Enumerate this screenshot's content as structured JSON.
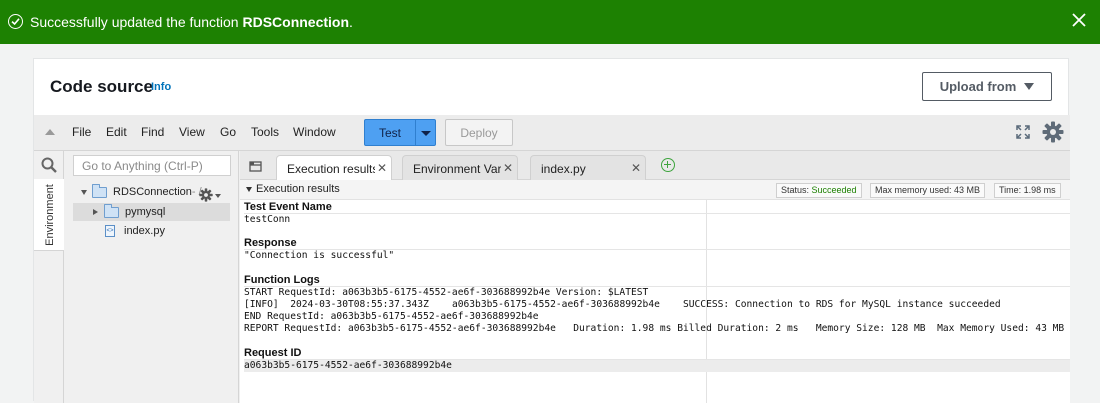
{
  "banner": {
    "message_prefix": "Successfully updated the function ",
    "function_name": "RDSConnection",
    "message_suffix": ".",
    "color": "#1d8102"
  },
  "card": {
    "title": "Code source",
    "info_link": "Info",
    "upload_button": "Upload from"
  },
  "menubar": {
    "items": [
      "File",
      "Edit",
      "Find",
      "View",
      "Go",
      "Tools",
      "Window"
    ],
    "test_button": "Test",
    "deploy_button": "Deploy",
    "accent": "#4ea0f2"
  },
  "sidebar": {
    "env_tab": "Environment",
    "search_placeholder": "Go to Anything (Ctrl-P)"
  },
  "tree": {
    "root": {
      "name": "RDSConnection",
      "suffix": " - /"
    },
    "items": [
      {
        "name": "pymysql",
        "type": "folder"
      },
      {
        "name": "index.py",
        "type": "file"
      }
    ]
  },
  "tabs": [
    {
      "label": "Execution results",
      "active": true
    },
    {
      "label": "Environment Vari",
      "active": false
    },
    {
      "label": "index.py",
      "active": false
    }
  ],
  "results": {
    "header": "Execution results",
    "status_label": "Status: ",
    "status_value": "Succeeded",
    "memory": "Max memory used: 43 MB",
    "time": "Time: 1.98 ms",
    "sections": {
      "test_event_title": "Test Event Name",
      "test_event_value": "testConn",
      "response_title": "Response",
      "response_value": "\"Connection is successful\"",
      "logs_title": "Function Logs",
      "logs": [
        "START RequestId: a063b3b5-6175-4552-ae6f-303688992b4e Version: $LATEST",
        "[INFO]\t2024-03-30T08:55:37.343Z\ta063b3b5-6175-4552-ae6f-303688992b4e\tSUCCESS: Connection to RDS for MySQL instance succeeded",
        "END RequestId: a063b3b5-6175-4552-ae6f-303688992b4e",
        "REPORT RequestId: a063b3b5-6175-4552-ae6f-303688992b4e\tDuration: 1.98 ms\tBilled Duration: 2 ms\tMemory Size: 128 MB\tMax Memory Used: 43 MB"
      ],
      "request_id_title": "Request ID",
      "request_id_value": "a063b3b5-6175-4552-ae6f-303688992b4e"
    }
  },
  "icons": [
    "check-circle-icon",
    "close-icon",
    "collapse-icon",
    "expand-icon",
    "gear-icon",
    "search-icon",
    "folder-icon",
    "file-icon",
    "tabs-menu-icon",
    "add-tab-icon"
  ]
}
